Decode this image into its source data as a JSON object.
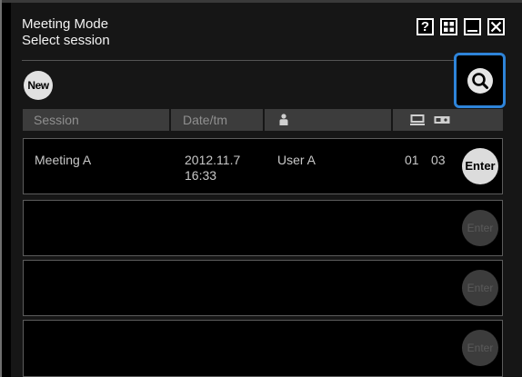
{
  "window": {
    "title": "Meeting Mode",
    "subtitle": "Select session",
    "controls": {
      "help": "?",
      "grid": "grid",
      "minimize": "_",
      "close": "X"
    }
  },
  "toolbar": {
    "new_label": "New",
    "search_icon": "search-icon"
  },
  "table": {
    "headers": {
      "session": "Session",
      "date": "Date/tm",
      "user_icon": "person-icon",
      "pc_icon": "monitor-icon",
      "projector_icon": "projector-icon"
    },
    "rows": [
      {
        "session": "Meeting A",
        "date": "2012.11.7",
        "time": "16:33",
        "user": "User A",
        "pc": "01",
        "projector": "03",
        "enter": "Enter",
        "active": true
      },
      {
        "session": "",
        "date": "",
        "time": "",
        "user": "",
        "pc": "",
        "projector": "",
        "enter": "Enter",
        "active": false
      },
      {
        "session": "",
        "date": "",
        "time": "",
        "user": "",
        "pc": "",
        "projector": "",
        "enter": "Enter",
        "active": false
      },
      {
        "session": "",
        "date": "",
        "time": "",
        "user": "",
        "pc": "",
        "projector": "",
        "enter": "Enter",
        "active": false
      }
    ]
  },
  "colors": {
    "accent_focus": "#2e84d9",
    "background": "#000000",
    "header_bg": "#3c3c3c"
  }
}
